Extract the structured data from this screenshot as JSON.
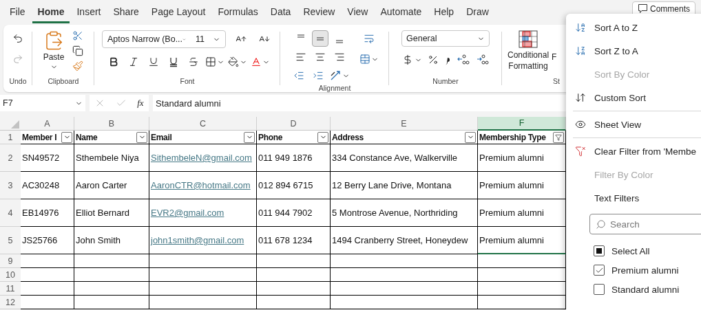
{
  "menu_tabs": [
    {
      "label": "File",
      "selected": false
    },
    {
      "label": "Home",
      "selected": true
    },
    {
      "label": "Insert",
      "selected": false
    },
    {
      "label": "Share",
      "selected": false
    },
    {
      "label": "Page Layout",
      "selected": false
    },
    {
      "label": "Formulas",
      "selected": false
    },
    {
      "label": "Data",
      "selected": false
    },
    {
      "label": "Review",
      "selected": false
    },
    {
      "label": "View",
      "selected": false
    },
    {
      "label": "Automate",
      "selected": false
    },
    {
      "label": "Help",
      "selected": false
    },
    {
      "label": "Draw",
      "selected": false
    }
  ],
  "comments_button": {
    "label": "Comments"
  },
  "ribbon": {
    "groups": [
      {
        "label": "Undo"
      },
      {
        "label": "Clipboard",
        "paste_label": "Paste"
      },
      {
        "label": "Font",
        "font_name": "Aptos Narrow (Bo...",
        "font_size": "11"
      },
      {
        "label": "Alignment"
      },
      {
        "label": "Number",
        "number_format": "General"
      },
      {
        "label": "St",
        "conditional_label": [
          "Conditional",
          "Formatting"
        ],
        "next_label": "F"
      }
    ]
  },
  "formula_bar": {
    "name_box": "F7",
    "fx": "fx",
    "value": "Standard alumni"
  },
  "sheet": {
    "column_letters": [
      "A",
      "B",
      "C",
      "D",
      "E",
      "F"
    ],
    "columns": [
      {
        "header": "Member I",
        "link": false,
        "filtered": false,
        "selected": false
      },
      {
        "header": "Name",
        "link": false,
        "filtered": false,
        "selected": false
      },
      {
        "header": "Email",
        "link": true,
        "filtered": false,
        "selected": false
      },
      {
        "header": "Phone",
        "link": false,
        "filtered": false,
        "selected": false
      },
      {
        "header": "Address",
        "link": false,
        "filtered": false,
        "selected": false
      },
      {
        "header": "Membership Type",
        "link": false,
        "filtered": true,
        "selected": true
      }
    ],
    "header_row": "1",
    "rows": [
      {
        "number": "2",
        "cells": [
          "SN49572",
          "Sthembele Niya",
          "SithembeleN@gmail.com",
          "011 949 1876",
          "334 Constance Ave, Walkerville",
          "Premium alumni"
        ]
      },
      {
        "number": "3",
        "cells": [
          "AC30248",
          "Aaron Carter",
          "AaronCTR@hotmail.com",
          "012 894 6715",
          "12 Berry Lane Drive, Montana",
          "Premium alumni"
        ]
      },
      {
        "number": "4",
        "cells": [
          "EB14976",
          "Elliot Bernard",
          "EVR2@gmail.com",
          "011 944 7902",
          "5 Montrose Avenue, Northriding",
          "Premium alumni"
        ]
      },
      {
        "number": "5",
        "cells": [
          "JS25766",
          "John Smith",
          "john1smith@gmail.com",
          "011 678 1234",
          "1494 Cranberry Street, Honeydew",
          "Premium alumni"
        ]
      },
      {
        "number": "9"
      },
      {
        "number": "10"
      },
      {
        "number": "11"
      },
      {
        "number": "12"
      }
    ]
  },
  "filter_menu": {
    "items": [
      {
        "kind": "sort-az",
        "label": "Sort A to Z",
        "disabled": false
      },
      {
        "kind": "sort-za",
        "label": "Sort Z to A",
        "disabled": false
      },
      {
        "kind": "plain",
        "label": "Sort By Color",
        "disabled": true
      },
      {
        "kind": "custom-sort",
        "label": "Custom Sort",
        "disabled": false
      },
      {
        "kind": "divider"
      },
      {
        "kind": "sheet-view",
        "label": "Sheet View",
        "disabled": false
      },
      {
        "kind": "divider"
      },
      {
        "kind": "clear-filter",
        "label": "Clear Filter from 'Membe",
        "disabled": false
      },
      {
        "kind": "plain",
        "label": "Filter By Color",
        "disabled": true
      },
      {
        "kind": "plain",
        "label": "Text Filters",
        "disabled": false
      }
    ],
    "search": {
      "placeholder": "Search"
    },
    "values": [
      {
        "label": "Select All",
        "checked": false,
        "indeterminate": true
      },
      {
        "label": "Premium alumni",
        "checked": true,
        "indeterminate": false
      },
      {
        "label": "Standard alumni",
        "checked": false,
        "indeterminate": false
      }
    ]
  }
}
